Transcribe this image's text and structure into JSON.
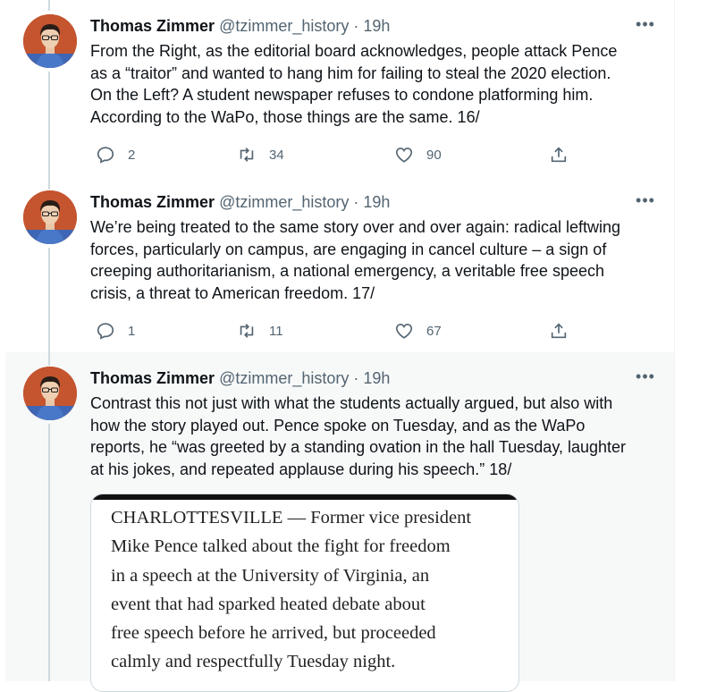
{
  "author": {
    "name": "Thomas Zimmer",
    "handle": "@tzimmer_history",
    "separator": "·",
    "avatar_icon": "user-avatar"
  },
  "more_label": "•••",
  "tweets": [
    {
      "time": "19h",
      "text": "From the Right, as the editorial board acknowledges, people attack Pence\nas a “traitor” and wanted to hang him for failing to steal the 2020 election.\nOn the Left? A student newspaper refuses to condone platforming him.\nAccording to the WaPo, those things are the same. 16/",
      "replies": "2",
      "retweets": "34",
      "likes": "90"
    },
    {
      "time": "19h",
      "text": "We’re being treated to the same story over and over again: radical leftwing\nforces, particularly on campus, are engaging in cancel culture – a sign of\ncreeping authoritarianism, a national emergency, a veritable free speech\ncrisis, a threat to American freedom. 17/",
      "replies": "1",
      "retweets": "11",
      "likes": "67"
    },
    {
      "time": "19h",
      "text": "Contrast this not just with what the students actually argued, but also with\nhow the story played out. Pence spoke on Tuesday, and as the WaPo\nreports, he “was greeted by a standing ovation in the hall Tuesday, laughter\nat his jokes, and repeated applause during his speech.” 18/",
      "image_text": "CHARLOTTESVILLE — Former vice president\nMike Pence talked about the fight for freedom\nin a speech at the University of Virginia, an\nevent that had sparked heated debate about\nfree speech before he arrived, but proceeded\ncalmly and respectfully Tuesday night."
    }
  ],
  "icons": {
    "reply": "reply-icon",
    "retweet": "retweet-icon",
    "like": "heart-icon",
    "share": "share-icon"
  },
  "colors": {
    "thread_line": "#cfd9de",
    "secondary_text": "#536471",
    "highlight_bg": "#f7f9f9"
  }
}
